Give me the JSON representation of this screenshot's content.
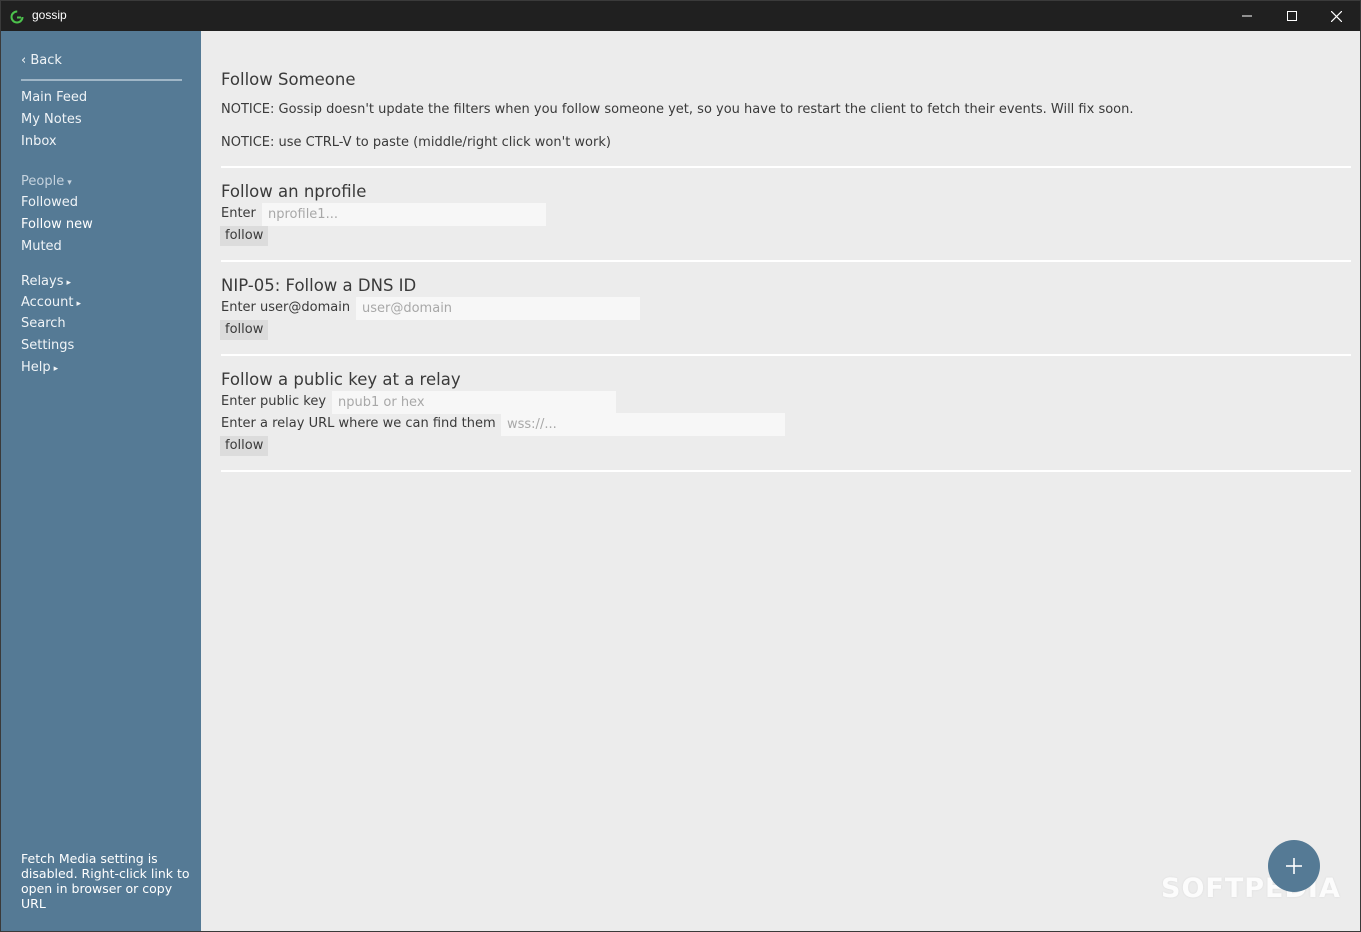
{
  "window": {
    "title": "gossip",
    "icon": "gossip-logo-icon",
    "controls": [
      "minimize-icon",
      "maximize-icon",
      "close-icon"
    ]
  },
  "sidebar": {
    "back": "‹ Back",
    "main_items": [
      "Main Feed",
      "My Notes",
      "Inbox"
    ],
    "people_header": "People",
    "people_caret": "▾",
    "people_items": [
      "Followed",
      "Follow new",
      "Muted"
    ],
    "selected": "Follow new",
    "other_items": [
      {
        "label": "Relays",
        "caret": "▸"
      },
      {
        "label": "Account",
        "caret": "▸"
      },
      {
        "label": "Search",
        "caret": ""
      },
      {
        "label": "Settings",
        "caret": ""
      },
      {
        "label": "Help",
        "caret": "▸"
      }
    ],
    "footer": "Fetch Media setting is disabled. Right-click link to open in browser or copy URL"
  },
  "main": {
    "title": "Follow Someone",
    "notice1": "NOTICE: Gossip doesn't update the filters when you follow someone yet, so you have to restart the client to fetch their events. Will fix soon.",
    "notice2": "NOTICE: use CTRL-V to paste (middle/right click won't work)",
    "nprofile": {
      "heading": "Follow an nprofile",
      "label": "Enter",
      "placeholder": "nprofile1...",
      "value": "",
      "button": "follow"
    },
    "nip05": {
      "heading": "NIP-05: Follow a DNS ID",
      "label": "Enter user@domain",
      "placeholder": "user@domain",
      "value": "",
      "button": "follow"
    },
    "pubkey": {
      "heading": "Follow a public key at a relay",
      "key_label": "Enter public key",
      "key_placeholder": "npub1 or hex",
      "relay_label": "Enter a relay URL where we can find them",
      "relay_placeholder": "wss://...",
      "button": "follow"
    },
    "fab_icon": "plus-icon",
    "watermark": "SOFTPEDIA"
  },
  "colors": {
    "sidebar_bg": "#557a95",
    "main_bg": "#ececec",
    "titlebar_bg": "#202020",
    "accent": "#557a95"
  }
}
